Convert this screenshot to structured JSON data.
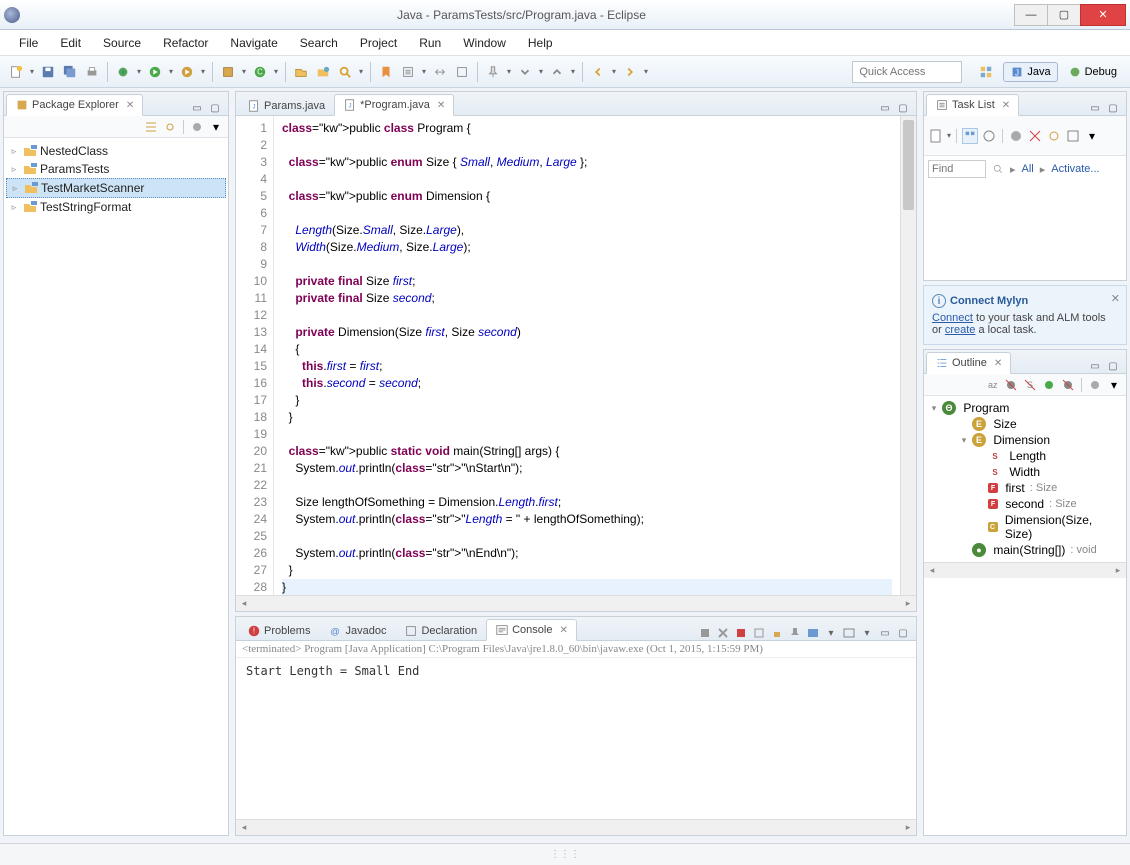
{
  "window": {
    "title": "Java - ParamsTests/src/Program.java - Eclipse"
  },
  "menubar": [
    "File",
    "Edit",
    "Source",
    "Refactor",
    "Navigate",
    "Search",
    "Project",
    "Run",
    "Window",
    "Help"
  ],
  "quick_access_placeholder": "Quick Access",
  "perspectives": {
    "java": "Java",
    "debug": "Debug"
  },
  "package_explorer": {
    "title": "Package Explorer",
    "items": [
      {
        "label": "NestedClass",
        "expandable": true
      },
      {
        "label": "ParamsTests",
        "expandable": true
      },
      {
        "label": "TestMarketScanner",
        "expandable": true,
        "selected": true
      },
      {
        "label": "TestStringFormat",
        "expandable": true
      }
    ]
  },
  "editor": {
    "tabs": [
      {
        "label": "Params.java",
        "active": false,
        "dirty": false
      },
      {
        "label": "*Program.java",
        "active": true,
        "dirty": true
      }
    ],
    "lines": [
      "public class Program {",
      "",
      "  public enum Size { Small, Medium, Large };",
      "",
      "  public enum Dimension {",
      "",
      "    Length(Size.Small, Size.Large),",
      "    Width(Size.Medium, Size.Large);",
      "",
      "    private final Size first;",
      "    private final Size second;",
      "",
      "    private Dimension(Size first, Size second)",
      "    {",
      "      this.first = first;",
      "      this.second = second;",
      "    }",
      "  }",
      "",
      "  public static void main(String[] args) {",
      "    System.out.println(\"\\nStart\\n\");",
      "",
      "    Size lengthOfSomething = Dimension.Length.first;",
      "    System.out.println(\"Length = \" + lengthOfSomething);",
      "",
      "    System.out.println(\"\\nEnd\\n\");",
      "  }",
      "}",
      ""
    ]
  },
  "bottom_tabs": {
    "problems": "Problems",
    "javadoc": "Javadoc",
    "declaration": "Declaration",
    "console": "Console"
  },
  "console": {
    "info": "<terminated> Program [Java Application] C:\\Program Files\\Java\\jre1.8.0_60\\bin\\javaw.exe (Oct 1, 2015, 1:15:59 PM)",
    "output": "Start\n\nLength = Small\n\nEnd"
  },
  "task_list": {
    "title": "Task List",
    "find": "Find",
    "all": "All",
    "activate": "Activate..."
  },
  "mylyn": {
    "title": "Connect Mylyn",
    "text1": "Connect",
    "text2": " to your task and ALM tools or ",
    "text3": "create",
    "text4": " a local task."
  },
  "outline": {
    "title": "Outline",
    "root": "Program",
    "items": [
      {
        "icon": "enum",
        "label": "Size",
        "indent": 1
      },
      {
        "icon": "enum",
        "label": "Dimension",
        "indent": 1,
        "expand": true
      },
      {
        "icon": "sf",
        "label": "Length",
        "indent": 2
      },
      {
        "icon": "sf",
        "label": "Width",
        "indent": 2
      },
      {
        "icon": "field",
        "label": "first",
        "type": ": Size",
        "indent": 2
      },
      {
        "icon": "field",
        "label": "second",
        "type": ": Size",
        "indent": 2
      },
      {
        "icon": "ctor",
        "label": "Dimension(Size, Size)",
        "indent": 2
      },
      {
        "icon": "meth",
        "label": "main(String[])",
        "type": ": void",
        "indent": 1
      }
    ]
  }
}
